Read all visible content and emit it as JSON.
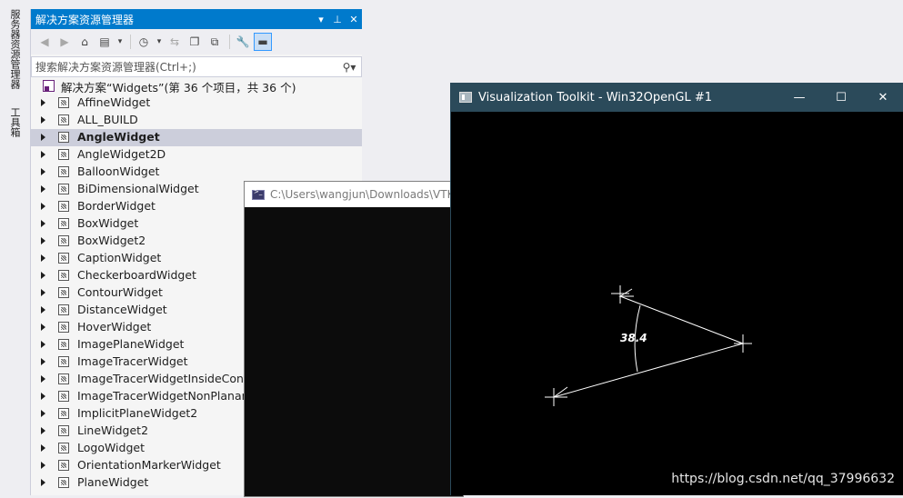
{
  "side_tabs": [
    "服务器资源管理器",
    "工具箱"
  ],
  "solution_explorer": {
    "title": "解决方案资源管理器",
    "title_buttons": [
      "dropdown-icon",
      "pin-icon",
      "close-icon"
    ],
    "search_placeholder": "搜索解决方案资源管理器(Ctrl+;)",
    "solution_label": "解决方案“Widgets”(第 36 个项目，共 36 个)",
    "selected_item": "AngleWidget",
    "items": [
      "AffineWidget",
      "ALL_BUILD",
      "AngleWidget",
      "AngleWidget2D",
      "BalloonWidget",
      "BiDimensionalWidget",
      "BorderWidget",
      "BoxWidget",
      "BoxWidget2",
      "CaptionWidget",
      "CheckerboardWidget",
      "ContourWidget",
      "DistanceWidget",
      "HoverWidget",
      "ImagePlaneWidget",
      "ImageTracerWidget",
      "ImageTracerWidgetInsideContour",
      "ImageTracerWidgetNonPlanar",
      "ImplicitPlaneWidget2",
      "LineWidget2",
      "LogoWidget",
      "OrientationMarkerWidget",
      "PlaneWidget"
    ]
  },
  "console": {
    "title": "C:\\Users\\wangjun\\Downloads\\VTK"
  },
  "vtk_window": {
    "title": "Visualization Toolkit - Win32OpenGL #1",
    "buttons": [
      "minimize-icon",
      "maximize-icon",
      "close-icon"
    ],
    "angle_value": "38.4",
    "watermark": "https://blog.csdn.net/qq_37996632"
  },
  "colors": {
    "titlebar_accent": "#007acc",
    "vtk_titlebar": "#2b4a5a",
    "selection": "#cccedb",
    "render_background": "#000000",
    "widget_lines": "#ffffff"
  }
}
